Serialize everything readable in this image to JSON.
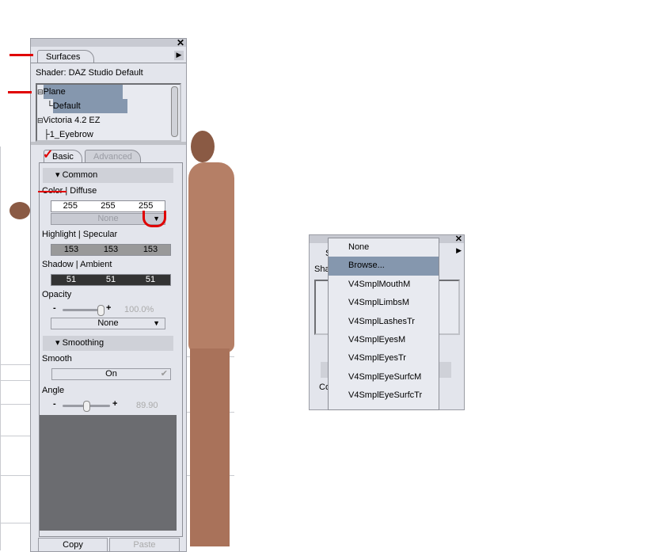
{
  "panel": {
    "tab_surfaces": "Surfaces",
    "shader": "Shader: DAZ Studio Default",
    "tree": [
      {
        "label": "Plane",
        "selected": true
      },
      {
        "label": "Default",
        "selected": true
      },
      {
        "label": "Victoria 4.2 EZ",
        "selected": false
      },
      {
        "label": "1_Eyebrow",
        "selected": false
      }
    ],
    "tab_basic": "Basic",
    "tab_advanced": "Advanced",
    "common": "Common",
    "color_label": "Color | Diffuse",
    "color": [
      "255",
      "255",
      "255"
    ],
    "color_map": "None",
    "highlight_label": "Highlight | Specular",
    "highlight": [
      "153",
      "153",
      "153"
    ],
    "shadow_label": "Shadow | Ambient",
    "shadow": [
      "51",
      "51",
      "51"
    ],
    "opacity_label": "Opacity",
    "opacity_value": "100.0%",
    "opacity_fraction": 1.0,
    "opacity_map": "None",
    "smoothing": "Smoothing",
    "smooth_label": "Smooth",
    "smooth_value": "On",
    "angle_label": "Angle",
    "angle_value": "89.90",
    "copy": "Copy",
    "paste": "Paste"
  },
  "panel2": {
    "tab_partial": "S",
    "shader_partial": "Sha",
    "co_partial": "Co",
    "menu": [
      "None",
      "Browse...",
      "V4SmplMouthM",
      "V4SmplLimbsM",
      "V4SmplLashesTr",
      "V4SmplEyesM",
      "V4SmplEyesTr",
      "V4SmplEyeSurfcM",
      "V4SmplEyeSurfcTr"
    ],
    "highlighted": "Browse..."
  },
  "colors": {
    "selection": "#8597ae",
    "panel": "#e3e5ec",
    "annotation": "#e00000"
  }
}
